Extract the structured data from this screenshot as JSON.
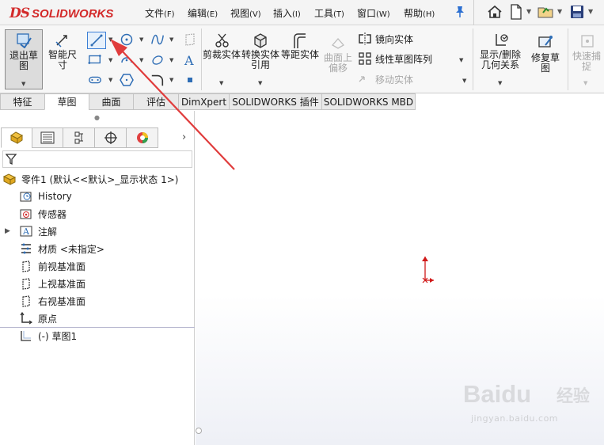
{
  "app": {
    "logo_ds": "DS",
    "logo_text": "SOLIDWORKS",
    "brand_color": "#d32a2a"
  },
  "menu": [
    {
      "label": "文件",
      "key": "(F)"
    },
    {
      "label": "编辑",
      "key": "(E)"
    },
    {
      "label": "视图",
      "key": "(V)"
    },
    {
      "label": "插入",
      "key": "(I)"
    },
    {
      "label": "工具",
      "key": "(T)"
    },
    {
      "label": "窗口",
      "key": "(W)"
    },
    {
      "label": "帮助",
      "key": "(H)"
    }
  ],
  "ribbon": {
    "exit_sketch": "退出草图",
    "smart_dimension": "智能尺寸",
    "trim_entities": "剪裁实体",
    "convert_entities": "转换实体引用",
    "offset_entities": "等距实体",
    "offset_on_surface": "曲面上偏移",
    "mirror_entities": "镜向实体",
    "linear_pattern": "线性草图阵列",
    "move_entities": "移动实体",
    "display_delete_relations": "显示/删除几何关系",
    "repair_sketch": "修复草图",
    "rapid_snaps": "快速捕捉"
  },
  "tabs": [
    "特征",
    "草图",
    "曲面",
    "评估",
    "DimXpert",
    "SOLIDWORKS 插件",
    "SOLIDWORKS MBD"
  ],
  "active_tab": "草图",
  "tree": {
    "root": "零件1 (默认<<默认>_显示状态 1>)",
    "items": [
      {
        "label": "History",
        "icon": "history-icon"
      },
      {
        "label": "传感器",
        "icon": "sensor-icon"
      },
      {
        "label": "注解",
        "icon": "annotation-icon"
      },
      {
        "label": "材质 <未指定>",
        "icon": "material-icon"
      },
      {
        "label": "前视基准面",
        "icon": "plane-icon"
      },
      {
        "label": "上视基准面",
        "icon": "plane-icon"
      },
      {
        "label": "右视基准面",
        "icon": "plane-icon"
      },
      {
        "label": "原点",
        "icon": "origin-icon"
      },
      {
        "label": "(-) 草图1",
        "icon": "sketch-icon"
      }
    ]
  },
  "watermark": {
    "brand": "Baidu",
    "brand_cn": "经验",
    "url": "jingyan.baidu.com"
  }
}
